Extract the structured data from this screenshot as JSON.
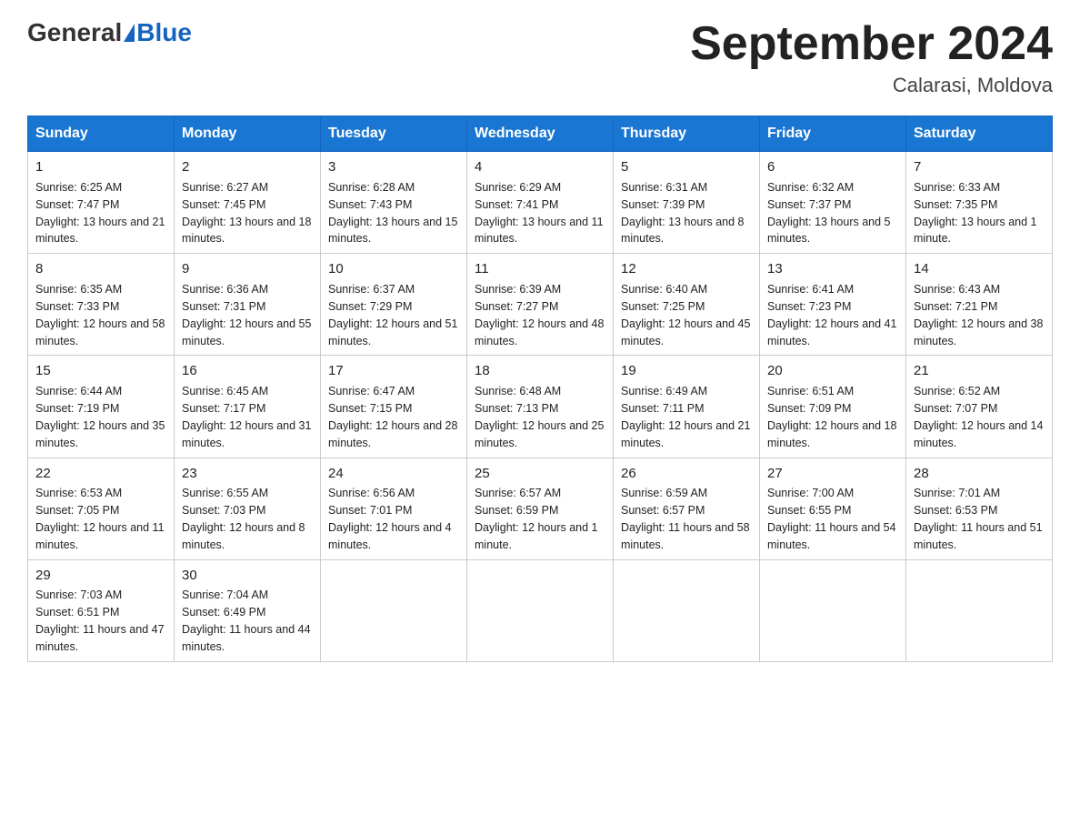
{
  "header": {
    "logo": {
      "part1": "General",
      "part2": "Blue"
    },
    "title": "September 2024",
    "location": "Calarasi, Moldova"
  },
  "days_of_week": [
    "Sunday",
    "Monday",
    "Tuesday",
    "Wednesday",
    "Thursday",
    "Friday",
    "Saturday"
  ],
  "weeks": [
    [
      {
        "day": "1",
        "sunrise": "6:25 AM",
        "sunset": "7:47 PM",
        "daylight": "13 hours and 21 minutes."
      },
      {
        "day": "2",
        "sunrise": "6:27 AM",
        "sunset": "7:45 PM",
        "daylight": "13 hours and 18 minutes."
      },
      {
        "day": "3",
        "sunrise": "6:28 AM",
        "sunset": "7:43 PM",
        "daylight": "13 hours and 15 minutes."
      },
      {
        "day": "4",
        "sunrise": "6:29 AM",
        "sunset": "7:41 PM",
        "daylight": "13 hours and 11 minutes."
      },
      {
        "day": "5",
        "sunrise": "6:31 AM",
        "sunset": "7:39 PM",
        "daylight": "13 hours and 8 minutes."
      },
      {
        "day": "6",
        "sunrise": "6:32 AM",
        "sunset": "7:37 PM",
        "daylight": "13 hours and 5 minutes."
      },
      {
        "day": "7",
        "sunrise": "6:33 AM",
        "sunset": "7:35 PM",
        "daylight": "13 hours and 1 minute."
      }
    ],
    [
      {
        "day": "8",
        "sunrise": "6:35 AM",
        "sunset": "7:33 PM",
        "daylight": "12 hours and 58 minutes."
      },
      {
        "day": "9",
        "sunrise": "6:36 AM",
        "sunset": "7:31 PM",
        "daylight": "12 hours and 55 minutes."
      },
      {
        "day": "10",
        "sunrise": "6:37 AM",
        "sunset": "7:29 PM",
        "daylight": "12 hours and 51 minutes."
      },
      {
        "day": "11",
        "sunrise": "6:39 AM",
        "sunset": "7:27 PM",
        "daylight": "12 hours and 48 minutes."
      },
      {
        "day": "12",
        "sunrise": "6:40 AM",
        "sunset": "7:25 PM",
        "daylight": "12 hours and 45 minutes."
      },
      {
        "day": "13",
        "sunrise": "6:41 AM",
        "sunset": "7:23 PM",
        "daylight": "12 hours and 41 minutes."
      },
      {
        "day": "14",
        "sunrise": "6:43 AM",
        "sunset": "7:21 PM",
        "daylight": "12 hours and 38 minutes."
      }
    ],
    [
      {
        "day": "15",
        "sunrise": "6:44 AM",
        "sunset": "7:19 PM",
        "daylight": "12 hours and 35 minutes."
      },
      {
        "day": "16",
        "sunrise": "6:45 AM",
        "sunset": "7:17 PM",
        "daylight": "12 hours and 31 minutes."
      },
      {
        "day": "17",
        "sunrise": "6:47 AM",
        "sunset": "7:15 PM",
        "daylight": "12 hours and 28 minutes."
      },
      {
        "day": "18",
        "sunrise": "6:48 AM",
        "sunset": "7:13 PM",
        "daylight": "12 hours and 25 minutes."
      },
      {
        "day": "19",
        "sunrise": "6:49 AM",
        "sunset": "7:11 PM",
        "daylight": "12 hours and 21 minutes."
      },
      {
        "day": "20",
        "sunrise": "6:51 AM",
        "sunset": "7:09 PM",
        "daylight": "12 hours and 18 minutes."
      },
      {
        "day": "21",
        "sunrise": "6:52 AM",
        "sunset": "7:07 PM",
        "daylight": "12 hours and 14 minutes."
      }
    ],
    [
      {
        "day": "22",
        "sunrise": "6:53 AM",
        "sunset": "7:05 PM",
        "daylight": "12 hours and 11 minutes."
      },
      {
        "day": "23",
        "sunrise": "6:55 AM",
        "sunset": "7:03 PM",
        "daylight": "12 hours and 8 minutes."
      },
      {
        "day": "24",
        "sunrise": "6:56 AM",
        "sunset": "7:01 PM",
        "daylight": "12 hours and 4 minutes."
      },
      {
        "day": "25",
        "sunrise": "6:57 AM",
        "sunset": "6:59 PM",
        "daylight": "12 hours and 1 minute."
      },
      {
        "day": "26",
        "sunrise": "6:59 AM",
        "sunset": "6:57 PM",
        "daylight": "11 hours and 58 minutes."
      },
      {
        "day": "27",
        "sunrise": "7:00 AM",
        "sunset": "6:55 PM",
        "daylight": "11 hours and 54 minutes."
      },
      {
        "day": "28",
        "sunrise": "7:01 AM",
        "sunset": "6:53 PM",
        "daylight": "11 hours and 51 minutes."
      }
    ],
    [
      {
        "day": "29",
        "sunrise": "7:03 AM",
        "sunset": "6:51 PM",
        "daylight": "11 hours and 47 minutes."
      },
      {
        "day": "30",
        "sunrise": "7:04 AM",
        "sunset": "6:49 PM",
        "daylight": "11 hours and 44 minutes."
      },
      null,
      null,
      null,
      null,
      null
    ]
  ]
}
